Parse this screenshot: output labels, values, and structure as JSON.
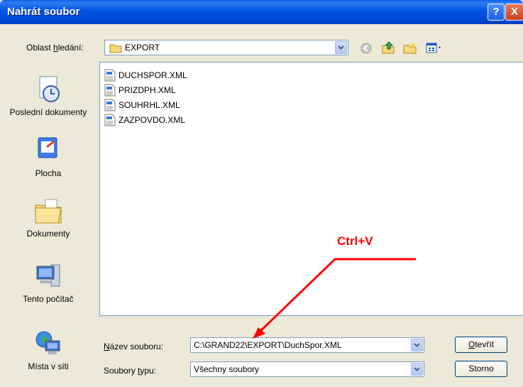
{
  "window": {
    "title": "Nahrát soubor",
    "help_label": "?",
    "close_label": "X"
  },
  "lookin": {
    "label_pre": "Oblast ",
    "label_u": "h",
    "label_post": "ledání:",
    "value": "EXPORT"
  },
  "places": [
    {
      "label": "Poslední dokumenty"
    },
    {
      "label": "Plocha"
    },
    {
      "label": "Dokumenty"
    },
    {
      "label": "Tento počítač"
    },
    {
      "label": "Místa v síti"
    }
  ],
  "files": [
    "DUCHSPOR.XML",
    "PRIZDPH.XML",
    "SOUHRHL.XML",
    "ZAZPOVDO.XML"
  ],
  "filename": {
    "label_u": "N",
    "label_post": "ázev souboru:",
    "value": "C:\\GRAND22\\EXPORT\\DuchSpor.XML"
  },
  "filetype": {
    "label_pre": "Soubory ",
    "label_u": "t",
    "label_post": "ypu:",
    "value": "Všechny soubory"
  },
  "buttons": {
    "open_u": "O",
    "open_post": "tevřít",
    "cancel": "Storno"
  },
  "annotation": {
    "text": "Ctrl+V",
    "color": "#ff0000"
  }
}
